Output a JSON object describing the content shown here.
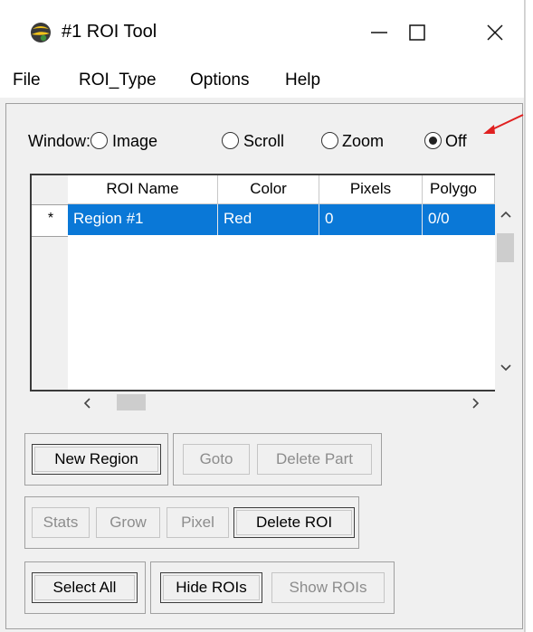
{
  "titlebar": {
    "title": "#1 ROI Tool",
    "icon": "idl-globe-icon"
  },
  "menu": [
    "File",
    "ROI_Type",
    "Options",
    "Help"
  ],
  "window_select": {
    "label": "Window:",
    "options": [
      "Image",
      "Scroll",
      "Zoom",
      "Off"
    ],
    "selected": "Off"
  },
  "table": {
    "columns": [
      "ROI Name",
      "Color",
      "Pixels",
      "Polygo"
    ],
    "rows": [
      {
        "marker": "*",
        "cells": [
          "Region #1",
          "Red",
          "0",
          "0/0"
        ]
      }
    ]
  },
  "buttons": {
    "new_region": "New Region",
    "goto": "Goto",
    "delete_part": "Delete Part",
    "stats": "Stats",
    "grow": "Grow",
    "pixel": "Pixel",
    "delete_roi": "Delete ROI",
    "select_all": "Select All",
    "hide_rois": "Hide ROIs",
    "show_rois": "Show ROIs"
  },
  "colors": {
    "selection": "#0a78d7",
    "annotation_arrow": "#e02020"
  }
}
